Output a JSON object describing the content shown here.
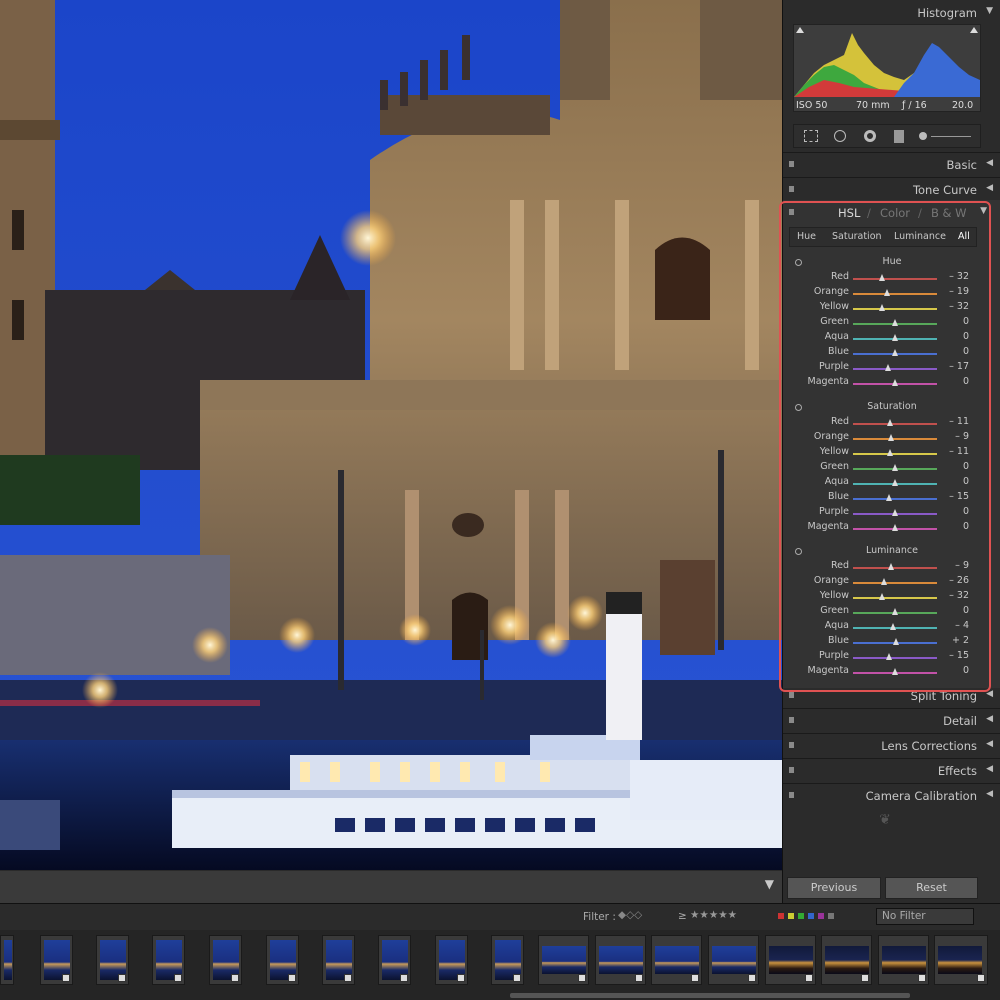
{
  "panels": {
    "histogram": "Histogram",
    "basic": "Basic",
    "tone_curve": "Tone Curve",
    "split_toning": "Split Toning",
    "detail": "Detail",
    "lens_corrections": "Lens Corrections",
    "effects": "Effects",
    "camera_calibration": "Camera Calibration"
  },
  "histogram_meta": {
    "iso": "ISO 50",
    "focal": "70 mm",
    "aperture": "ƒ / 16",
    "shutter": "20.0"
  },
  "hsl": {
    "title_hsl": "HSL",
    "sep1": "/",
    "title_color": "Color",
    "sep2": "/",
    "title_bw": "B & W",
    "tabs": [
      "Hue",
      "Saturation",
      "Luminance",
      "All"
    ],
    "sections": [
      {
        "title": "Hue",
        "rows": [
          {
            "name": "Red",
            "value": "– 32",
            "num": -32
          },
          {
            "name": "Orange",
            "value": "– 19",
            "num": -19
          },
          {
            "name": "Yellow",
            "value": "– 32",
            "num": -32
          },
          {
            "name": "Green",
            "value": "0",
            "num": 0
          },
          {
            "name": "Aqua",
            "value": "0",
            "num": 0
          },
          {
            "name": "Blue",
            "value": "0",
            "num": 0
          },
          {
            "name": "Purple",
            "value": "– 17",
            "num": -17
          },
          {
            "name": "Magenta",
            "value": "0",
            "num": 0
          }
        ]
      },
      {
        "title": "Saturation",
        "rows": [
          {
            "name": "Red",
            "value": "– 11",
            "num": -11
          },
          {
            "name": "Orange",
            "value": "– 9",
            "num": -9
          },
          {
            "name": "Yellow",
            "value": "– 11",
            "num": -11
          },
          {
            "name": "Green",
            "value": "0",
            "num": 0
          },
          {
            "name": "Aqua",
            "value": "0",
            "num": 0
          },
          {
            "name": "Blue",
            "value": "– 15",
            "num": -15
          },
          {
            "name": "Purple",
            "value": "0",
            "num": 0
          },
          {
            "name": "Magenta",
            "value": "0",
            "num": 0
          }
        ]
      },
      {
        "title": "Luminance",
        "rows": [
          {
            "name": "Red",
            "value": "– 9",
            "num": -9
          },
          {
            "name": "Orange",
            "value": "– 26",
            "num": -26
          },
          {
            "name": "Yellow",
            "value": "– 32",
            "num": -32
          },
          {
            "name": "Green",
            "value": "0",
            "num": 0
          },
          {
            "name": "Aqua",
            "value": "– 4",
            "num": -4
          },
          {
            "name": "Blue",
            "value": "+ 2",
            "num": 2
          },
          {
            "name": "Purple",
            "value": "– 15",
            "num": -15
          },
          {
            "name": "Magenta",
            "value": "0",
            "num": 0
          }
        ]
      }
    ]
  },
  "buttons": {
    "previous": "Previous",
    "reset": "Reset"
  },
  "filter": {
    "label": "Filter :",
    "preset": "No Filter",
    "rating_op": "≥",
    "stars": "★★★★★"
  },
  "colors": {
    "highlight": "#e05252",
    "sky": "#1d47c8",
    "track_colors": [
      "#c0504d",
      "#d98a3a",
      "#d6c84a",
      "#57a85a",
      "#4fb3b3",
      "#4a6fd0",
      "#8a5ac7",
      "#c252a8"
    ]
  }
}
